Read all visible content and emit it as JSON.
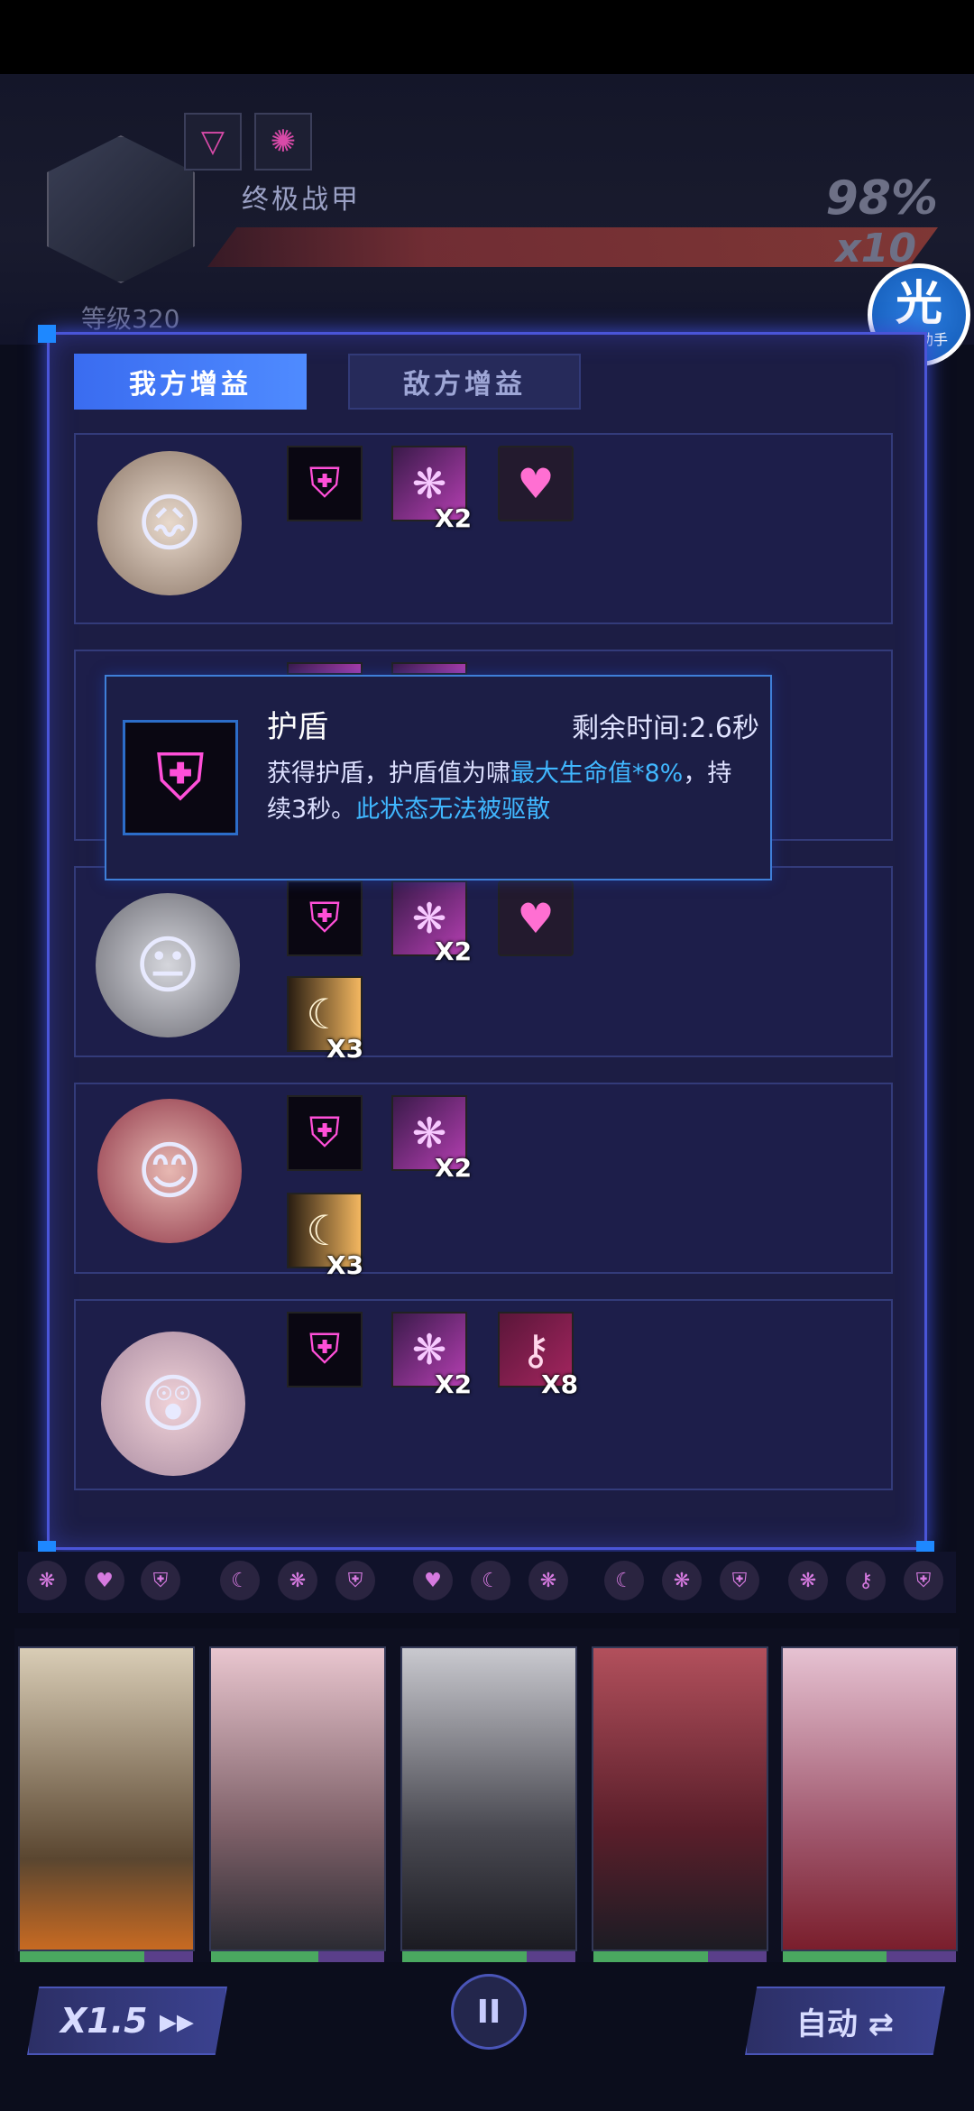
{
  "boss": {
    "name": "终极战甲",
    "hp_percent": "98%",
    "hp_multiplier": "x10",
    "level": "等级320"
  },
  "helper": {
    "glyph": "光",
    "label": "光环助手"
  },
  "tabs": {
    "ally": "我方增益",
    "enemy": "敌方增益"
  },
  "rows": [
    {
      "icons": [
        {
          "name": "shield-buff-icon",
          "glyph": "⛨",
          "count": ""
        },
        {
          "name": "wing-buff-icon",
          "glyph": "❋",
          "count": "X2"
        },
        {
          "name": "heart-buff-icon",
          "glyph": "♥",
          "count": ""
        }
      ]
    },
    {
      "icons": []
    },
    {
      "icons": [
        {
          "name": "shield-buff-icon",
          "glyph": "⛨",
          "count": ""
        },
        {
          "name": "wing-buff-icon",
          "glyph": "❋",
          "count": "X2"
        },
        {
          "name": "heart-buff-icon",
          "glyph": "♥",
          "count": ""
        },
        {
          "name": "moon-buff-icon",
          "glyph": "☾",
          "count": "X3"
        }
      ]
    },
    {
      "icons": [
        {
          "name": "shield-buff-icon",
          "glyph": "⛨",
          "count": ""
        },
        {
          "name": "wing-buff-icon",
          "glyph": "❋",
          "count": "X2"
        },
        {
          "name": "moon-buff-icon",
          "glyph": "☾",
          "count": "X3"
        }
      ]
    },
    {
      "icons": [
        {
          "name": "shield-buff-icon",
          "glyph": "⛨",
          "count": ""
        },
        {
          "name": "wing-buff-icon",
          "glyph": "❋",
          "count": "X2"
        },
        {
          "name": "key-buff-icon",
          "glyph": "⚷",
          "count": "X8"
        }
      ]
    }
  ],
  "tooltip": {
    "title": "护盾",
    "time": "剩余时间:2.6秒",
    "desc_prefix": "获得护盾，护盾值为啸",
    "desc_highlight1": "最大生命值*8%",
    "desc_mid": "，持续3秒。",
    "desc_highlight2": "此状态无法被驱散"
  },
  "controls": {
    "speed": "X1.5 ▸▸",
    "pause": "II",
    "auto": "自动 ⇄"
  },
  "characters_hp": [
    0.72,
    0.62,
    0.72,
    0.66,
    0.6
  ],
  "colors": {
    "accent": "#4a55d8",
    "highlight": "#40b7ff",
    "buff_pink": "#ff4fd8"
  }
}
